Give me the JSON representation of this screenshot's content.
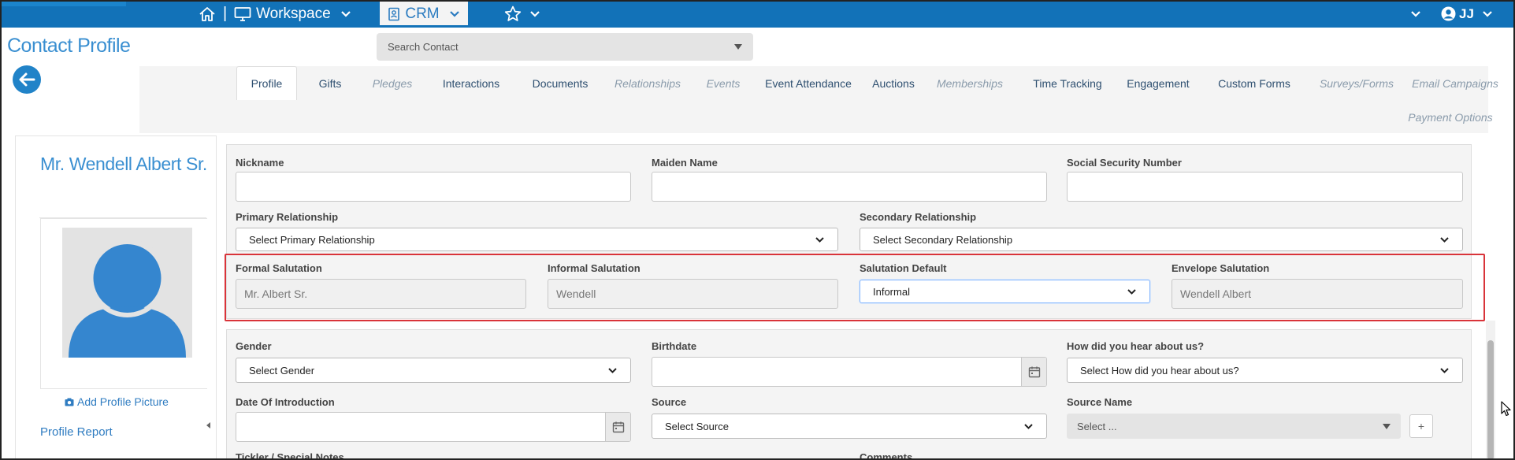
{
  "topbar": {
    "home_separator": "|",
    "workspace_label": "Workspace",
    "crm_label": "CRM",
    "user_initials": "JJ",
    "icons": [
      "home-icon",
      "monitor-icon",
      "address-book-icon",
      "star-icon",
      "user-circle-icon",
      "chevron-down-icon"
    ]
  },
  "header": {
    "page_title": "Contact Profile",
    "search_placeholder": "Search Contact"
  },
  "tabs": [
    {
      "label": "Profile",
      "state": "active"
    },
    {
      "label": "Gifts",
      "state": "enabled"
    },
    {
      "label": "Pledges",
      "state": "disabled"
    },
    {
      "label": "Interactions",
      "state": "enabled"
    },
    {
      "label": "Documents",
      "state": "enabled"
    },
    {
      "label": "Relationships",
      "state": "disabled"
    },
    {
      "label": "Events",
      "state": "disabled"
    },
    {
      "label": "Event Attendance",
      "state": "enabled"
    },
    {
      "label": "Auctions",
      "state": "enabled"
    },
    {
      "label": "Memberships",
      "state": "disabled"
    },
    {
      "label": "Time Tracking",
      "state": "enabled"
    },
    {
      "label": "Engagement",
      "state": "enabled"
    },
    {
      "label": "Custom Forms",
      "state": "enabled"
    },
    {
      "label": "Surveys/Forms",
      "state": "disabled"
    },
    {
      "label": "Email Campaigns",
      "state": "disabled"
    },
    {
      "label": "Payment Options",
      "state": "disabled"
    }
  ],
  "profile": {
    "name": "Mr. Wendell Albert Sr.",
    "add_picture_label": "Add Profile Picture",
    "profile_report_label": "Profile Report"
  },
  "form": {
    "nickname": {
      "label": "Nickname",
      "value": ""
    },
    "maiden_name": {
      "label": "Maiden Name",
      "value": ""
    },
    "ssn": {
      "label": "Social Security Number",
      "value": ""
    },
    "primary_relationship": {
      "label": "Primary Relationship",
      "value": "Select Primary Relationship"
    },
    "secondary_relationship": {
      "label": "Secondary Relationship",
      "value": "Select Secondary Relationship"
    },
    "formal_salutation": {
      "label": "Formal Salutation",
      "value": "Mr. Albert Sr."
    },
    "informal_salutation": {
      "label": "Informal Salutation",
      "value": "Wendell"
    },
    "salutation_default": {
      "label": "Salutation Default",
      "value": "Informal"
    },
    "envelope_salutation": {
      "label": "Envelope Salutation",
      "value": "Wendell Albert"
    },
    "gender": {
      "label": "Gender",
      "value": "Select Gender"
    },
    "birthdate": {
      "label": "Birthdate",
      "value": ""
    },
    "heard_about": {
      "label": "How did you hear about us?",
      "value": "Select How did you hear about us?"
    },
    "date_of_introduction": {
      "label": "Date Of Introduction",
      "value": ""
    },
    "source": {
      "label": "Source",
      "value": "Select Source"
    },
    "source_name": {
      "label": "Source Name",
      "value": "Select ...",
      "add_label": "+"
    },
    "tickler_notes": {
      "label": "Tickler / Special Notes"
    },
    "comments": {
      "label": "Comments"
    }
  },
  "colors": {
    "topbar": "#1272b8",
    "accent": "#3a8fd1",
    "link": "#2f7cc1",
    "highlight": "#d9343a"
  }
}
